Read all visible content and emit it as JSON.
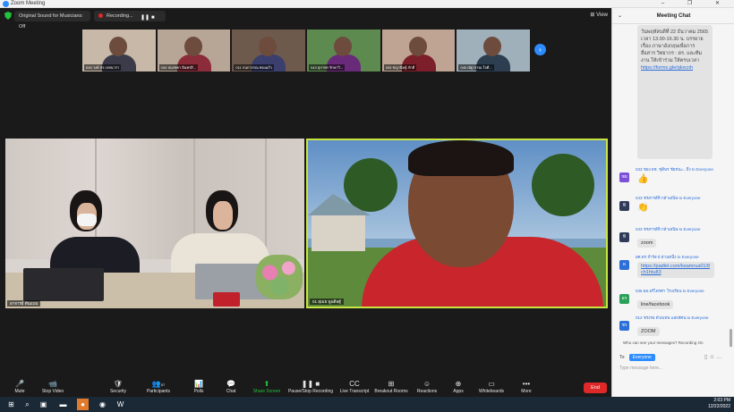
{
  "window": {
    "title": "Zoom Meeting",
    "controls": "–  ❐  ✕"
  },
  "topbar": {
    "sound_label": "Original Sound for Musicians: Off",
    "recording_label": "Recording...",
    "pause_glyph": "❚❚",
    "stop_glyph": "■",
    "view_label": "⊞ View"
  },
  "thumbnails": [
    {
      "name": "045 วงษ์ สร เกศนารา"
    },
    {
      "name": "034 ปนรพยา อินทรสิ..."
    },
    {
      "name": "011 กนกวรรณ ทองแก้ว"
    },
    {
      "name": "043 สุภาพร รักษาวิ..."
    },
    {
      "name": "033 ชญานิษฐ์ ภักดี"
    },
    {
      "name": "040 ณัฐวรรณ ใจดี..."
    }
  ],
  "main_tiles": {
    "left_name": "อาจารย์ ต้นแบบ",
    "right_name": "01 สุเมธ พูนดิษฐ์"
  },
  "toolbar": {
    "items": [
      {
        "icon": "🎤",
        "label": "Mute"
      },
      {
        "icon": "📹",
        "label": "Stop Video"
      },
      {
        "icon": "🛡",
        "label": "Security"
      },
      {
        "icon": "👥",
        "label": "Participants",
        "count": "57"
      },
      {
        "icon": "📊",
        "label": "Polls"
      },
      {
        "icon": "💬",
        "label": "Chat"
      },
      {
        "icon": "⬆",
        "label": "Share Screen"
      },
      {
        "icon": "❚❚ ■",
        "label": "Pause/Stop Recording"
      },
      {
        "icon": "CC",
        "label": "Live Transcript"
      },
      {
        "icon": "⊞",
        "label": "Breakout Rooms"
      },
      {
        "icon": "☺",
        "label": "Reactions"
      },
      {
        "icon": "⊕",
        "label": "Apps"
      },
      {
        "icon": "▭",
        "label": "Whiteboards"
      },
      {
        "icon": "•••",
        "label": "More"
      }
    ],
    "end_label": "End"
  },
  "chat": {
    "title": "Meeting Chat",
    "long_message": "วันพฤหัสบดีที่ 22 ธันวาคม 2565 เวลา 13.00-16.30 น. บรรยายเรื่อง ภาษาอังกฤษเพื่อการสื่อสาร วิทยากร : ดร. และทีมงาน ให้เข้าร่วม ให้ครบเวลา",
    "long_link": "https://forms.gle/qkxcnh",
    "messages": [
      {
        "from": "033 ชยง ผช. ชุติพร ชัยชนะ...ถึง to Everyone",
        "kind": "emoji",
        "text": "👍",
        "avatar": "ชย",
        "color": "#7b4fd8"
      },
      {
        "from": "043 ชรสารส์ทิ กล้าเสนิษ to Everyone",
        "kind": "emoji",
        "text": "👏",
        "avatar": "ทิ",
        "color": "#2f3b58"
      },
      {
        "from": "043 ชรสารส์ทิ กล้าเสนิษ to Everyone",
        "kind": "text",
        "text": "zoom",
        "avatar": "ทิ",
        "color": "#2f3b58"
      },
      {
        "from": "ผศ.ดร.จำรัส ย่ ส่วนหนึ่ง to Everyone",
        "kind": "link",
        "text": "https://padlet.com/keamrua01/8ch1htu83",
        "avatar": "ผ",
        "color": "#2d6fd8"
      },
      {
        "from": "036 ผอ.อร์ไตรศา โรงเรียน to Everyone",
        "kind": "text",
        "text": "line/facebook",
        "avatar": "อร",
        "color": "#2aa05a"
      },
      {
        "from": "012 ชรงรย ด้วยเทพ แสงทัศน to Everyone",
        "kind": "text",
        "text": "ZOOM",
        "avatar": "ชร",
        "color": "#2d6fd8"
      }
    ],
    "who_can_see": "Who can see your messages? Recording On",
    "to_label": "To:",
    "to_value": "Everyone",
    "input_placeholder": "Type message here..."
  },
  "taskbar": {
    "time": "2:03 PM",
    "date": "12/22/2022"
  },
  "colors": {
    "accent": "#2d8cff",
    "active_speaker": "#c9e542",
    "end": "#e02828",
    "share": "#23c23e"
  }
}
